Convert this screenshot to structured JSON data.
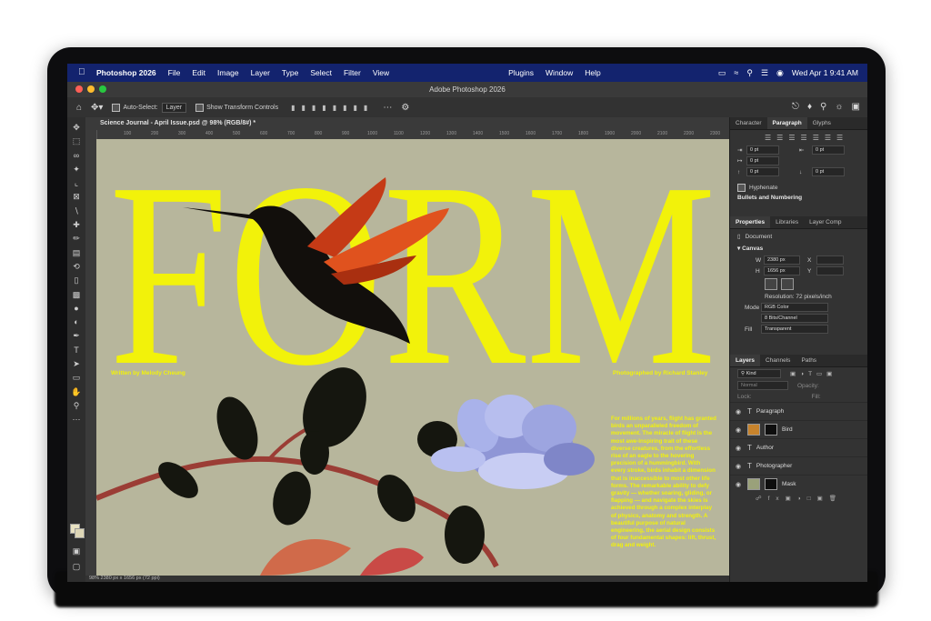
{
  "menubar": {
    "app_name": "Photoshop 2026",
    "items": [
      "File",
      "Edit",
      "Image",
      "Layer",
      "Type",
      "Select",
      "Filter",
      "View"
    ],
    "items_right": [
      "Plugins",
      "Window",
      "Help"
    ],
    "clock": "Wed Apr 1  9:41 AM"
  },
  "window": {
    "title": "Adobe Photoshop 2026"
  },
  "options_bar": {
    "auto_select_label": "Auto-Select:",
    "auto_select_value": "Layer",
    "transform_label": "Show Transform Controls"
  },
  "document": {
    "tab_label": "Science Journal - April Issue.psd @ 98% (RGB/8#) *",
    "ruler_ticks": [
      "100",
      "200",
      "300",
      "400",
      "500",
      "600",
      "700",
      "800",
      "900",
      "1000",
      "1100",
      "1200",
      "1300",
      "1400",
      "1500",
      "1600",
      "1700",
      "1800",
      "1900",
      "2000",
      "2100",
      "2200",
      "2300"
    ],
    "status": "98%      2380 px x 1656 px (72 ppi)"
  },
  "artwork": {
    "headline": "FORM",
    "written_by": "Written by Melody Cheung",
    "photographed_by": "Photographed by Richard Stanley",
    "body_text": "For millions of years, flight has granted birds an unparalleled freedom of movement. The miracle of flight is the most awe-inspiring trait of these diverse creatures, from the effortless rise of an eagle to the hovering precision of a hummingbird. With every stroke, birds inhabit a dimension that is inaccessible to most other life forms. The remarkable ability to defy gravity — whether soaring, gliding, or flapping — and navigate the skies is achieved through a complex interplay of physics, anatomy and strength. A beautiful purpose of natural engineering, the aerial design consists of four fundamental shapes: lift, thrust, drag and weight.",
    "headline_color": "#f2f20a",
    "background_color": "#b7b69c"
  },
  "character_panel": {
    "tabs": [
      "Character",
      "Paragraph",
      "Glyphs"
    ],
    "active_tab": "Paragraph",
    "indent_values": [
      "0 pt",
      "0 pt",
      "0 pt",
      "0 pt",
      "0 pt"
    ],
    "hyphenate_label": "Hyphenate",
    "bullets_label": "Bullets and Numbering"
  },
  "properties_panel": {
    "tabs": [
      "Properties",
      "Libraries",
      "Layer Comp"
    ],
    "document_label": "Document",
    "canvas_label": "Canvas",
    "width": "2380 px",
    "height": "1656 px",
    "width_label": "W",
    "height_label": "H",
    "x_label": "X",
    "y_label": "Y",
    "resolution": "Resolution: 72 pixels/inch",
    "mode_label": "Mode",
    "mode_value": "RGB Color",
    "bits_value": "8 Bits/Channel",
    "fill_label": "Fill",
    "fill_value": "Transparent"
  },
  "layers_panel": {
    "tabs": [
      "Layers",
      "Channels",
      "Paths"
    ],
    "kind_label": "Kind",
    "blend_mode": "Normal",
    "opacity_label": "Opacity:",
    "lock_label": "Lock:",
    "fill_label": "Fill:",
    "layers": [
      {
        "name": "Paragraph",
        "type": "text"
      },
      {
        "name": "Bird",
        "type": "image"
      },
      {
        "name": "Author",
        "type": "text"
      },
      {
        "name": "Photographer",
        "type": "text"
      },
      {
        "name": "Mask",
        "type": "image"
      }
    ]
  },
  "colors": {
    "menubar": "#13236e",
    "panel": "#333333",
    "accent_yellow": "#f2f20a"
  }
}
